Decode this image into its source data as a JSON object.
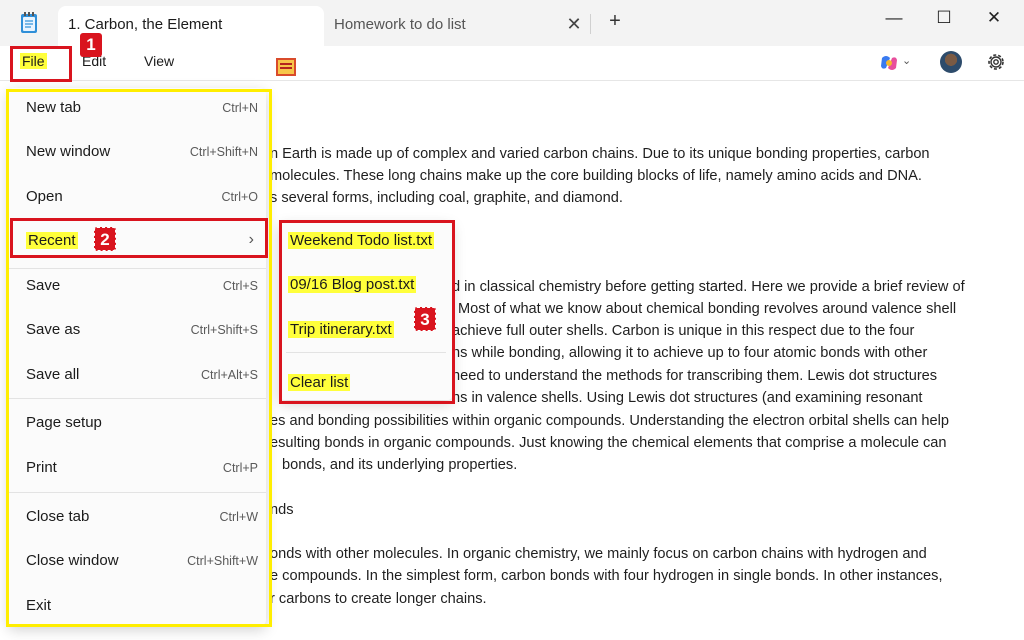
{
  "titlebar": {
    "tabs": [
      {
        "title": "1. Carbon, the Element",
        "active": true
      },
      {
        "title": "Homework to do list",
        "active": false
      }
    ],
    "new_tab": "+",
    "window_controls": {
      "minimize": "—",
      "maximize": "☐",
      "close": "✕"
    }
  },
  "menubar": {
    "file": "File",
    "edit": "Edit",
    "view": "View"
  },
  "document": {
    "lines": [
      "n Earth is made up of complex and varied carbon chains. Due to its unique bonding properties, carbon",
      "molecules. These long chains make up the core building blocks of life, namely amino acids and DNA.",
      "s several forms, including coal, graphite, and diamond.",
      "d in classical chemistry before getting started. Here we provide a brief review of",
      "Most of what we know about chemical bonding revolves around valence shell",
      "achieve full outer shells. Carbon is unique in this respect due to the four",
      "ns while bonding, allowing it to achieve up to four atomic bonds with other",
      "need to understand the methods for transcribing them. Lewis dot structures",
      "ns in valence shells. Using Lewis dot structures (and examining resonant",
      "es and bonding possibilities within organic compounds. Understanding the electron orbital shells can help",
      "esulting bonds in organic compounds. Just knowing the chemical elements that comprise a molecule can",
      "bonds, and its underlying properties.",
      "nds",
      "onds with other molecules. In organic chemistry, we mainly focus on carbon chains with hydrogen and",
      "e compounds. In the simplest form, carbon bonds with four hydrogen in single bonds. In other instances,",
      "r carbons to create longer chains."
    ]
  },
  "file_menu": {
    "items": [
      {
        "label": "New tab",
        "shortcut": "Ctrl+N"
      },
      {
        "label": "New window",
        "shortcut": "Ctrl+Shift+N"
      },
      {
        "label": "Open",
        "shortcut": "Ctrl+O"
      },
      {
        "label": "Recent",
        "shortcut": ""
      },
      {
        "label": "Save",
        "shortcut": "Ctrl+S"
      },
      {
        "label": "Save as",
        "shortcut": "Ctrl+Shift+S"
      },
      {
        "label": "Save all",
        "shortcut": "Ctrl+Alt+S"
      },
      {
        "label": "Page setup",
        "shortcut": ""
      },
      {
        "label": "Print",
        "shortcut": "Ctrl+P"
      },
      {
        "label": "Close tab",
        "shortcut": "Ctrl+W"
      },
      {
        "label": "Close window",
        "shortcut": "Ctrl+Shift+W"
      },
      {
        "label": "Exit",
        "shortcut": ""
      }
    ]
  },
  "recent_menu": {
    "items": [
      {
        "label": "Weekend Todo list.txt"
      },
      {
        "label": "09/16 Blog post.txt"
      },
      {
        "label": "Trip itinerary.txt"
      },
      {
        "label": "Clear list"
      }
    ]
  },
  "annotations": {
    "badges": [
      "1",
      "2",
      "3"
    ],
    "highlight_color": "#ffff3b",
    "box_red": "#d9141e",
    "box_yellow": "#ffee00"
  },
  "icons": {
    "app": "notepad-icon",
    "copilot": "copilot-icon",
    "settings": "gear-icon",
    "user": "avatar",
    "submenu": "chevron-right-icon"
  }
}
